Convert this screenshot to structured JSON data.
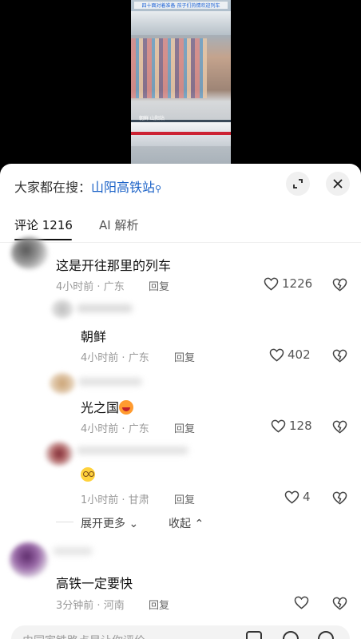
{
  "video": {
    "caption": "四十面对着准备 孩子们热情欢迎列车",
    "overlay_tag": "朝鲜 山阳站"
  },
  "search": {
    "prefix": "大家都在搜：",
    "keyword": "山阳高铁站"
  },
  "tabs": [
    {
      "label": "评论 1216",
      "active": true
    },
    {
      "label": "AI 解析",
      "active": false
    }
  ],
  "comments": [
    {
      "text": "这是开往那里的列车",
      "time": "4小时前",
      "location": "广东",
      "reply": "回复",
      "likes": "1226",
      "level": "top"
    },
    {
      "text": "朝鲜",
      "time": "4小时前",
      "location": "广东",
      "reply": "回复",
      "likes": "402",
      "level": "sub"
    },
    {
      "text": "光之国",
      "emoji": "grin-emoji",
      "time": "4小时前",
      "location": "广东",
      "reply": "回复",
      "likes": "128",
      "level": "sub"
    },
    {
      "text": "",
      "emoji": "dizzy-emoji",
      "time": "1小时前",
      "location": "甘肃",
      "reply": "回复",
      "likes": "4",
      "level": "sub"
    },
    {
      "text": "高铁一定要快",
      "time": "3分钟前",
      "location": "河南",
      "reply": "回复",
      "likes": "",
      "level": "top"
    }
  ],
  "thread_controls": {
    "expand_more": "展开更多",
    "collapse": "收起"
  },
  "input": {
    "placeholder": "由同家铁路点是让你评价"
  },
  "meta_sep": " · "
}
